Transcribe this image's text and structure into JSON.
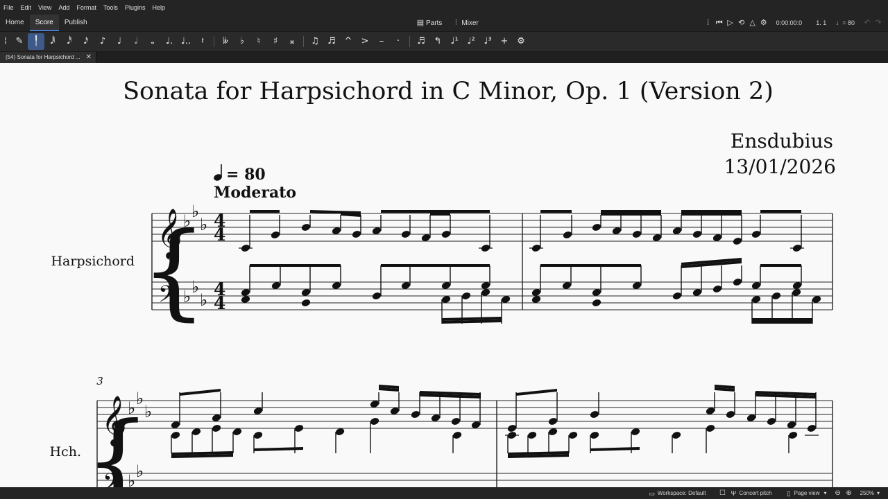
{
  "menu": [
    "File",
    "Edit",
    "View",
    "Add",
    "Format",
    "Tools",
    "Plugins",
    "Help"
  ],
  "workspace_tabs": [
    "Home",
    "Score",
    "Publish"
  ],
  "toolbar": {
    "parts_label": "Parts",
    "mixer_label": "Mixer",
    "time_display": "0:00:00:0",
    "position_display": "1. 1",
    "tempo_display": "♩= 80"
  },
  "note_input_buttons": [
    "✎",
    "𝅘𝅥𝅱",
    "𝅘𝅥𝅰",
    "𝅘𝅥𝅯",
    "♪",
    "♩",
    "𝅗𝅥",
    "𝅝",
    "♩.",
    "𝅘𝅥.."
  ],
  "document_tab": "(54) Sonata for Harpsichord ...",
  "score": {
    "title": "Sonata for Harpsichord in C Minor, Op. 1 (Version 2)",
    "composer": "Ensdubius",
    "date": "13/01/2026",
    "tempo_marking": "= 80",
    "tempo_text": "Moderato",
    "instrument_full": "Harpsichord",
    "instrument_short": "Hch.",
    "measure_number": "3"
  },
  "status": {
    "workspace": "Workspace: Default",
    "concert_pitch": "Concert pitch",
    "view_mode": "Page view",
    "zoom": "250%"
  }
}
